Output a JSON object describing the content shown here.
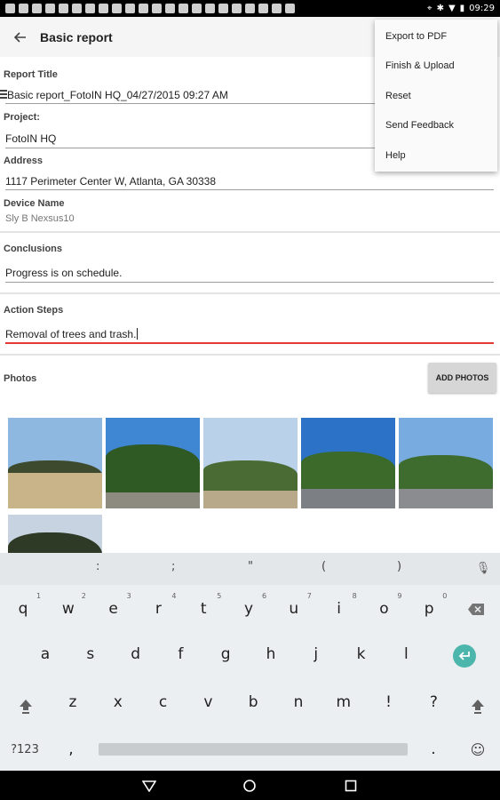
{
  "status_bar": {
    "time": "09:29",
    "left_icons": [
      "gmail-icon",
      "calendar-icon",
      "image-icon",
      "photos-icon",
      "twitter-icon",
      "twitter-icon",
      "snowflake-icon",
      "twitter-icon",
      "snowflake-icon",
      "snowflake-icon",
      "twitter-icon",
      "twitter-icon",
      "twitter-icon",
      "hangouts-icon",
      "twitter-icon",
      "card-icon",
      "sync-icon",
      "linkedin-icon",
      "linkedin-icon",
      "warning-icon",
      "notification-icon",
      "bag-icon"
    ]
  },
  "toolbar": {
    "title": "Basic report"
  },
  "menu": {
    "items": [
      "Export to PDF",
      "Finish & Upload",
      "Reset",
      "Send Feedback",
      "Help"
    ]
  },
  "form": {
    "report_title_label": "Report Title",
    "report_title_value": "Basic report_FotoIN HQ_04/27/2015 09:27 AM",
    "project_label": "Project:",
    "project_value": "FotoIN HQ",
    "address_label": "Address",
    "address_value": "1117 Perimeter Center W, Atlanta, GA 30338",
    "device_label": "Device Name",
    "device_value": "Sly B Nexsus10",
    "conclusions_label": "Conclusions",
    "conclusions_value": "Progress is on schedule.",
    "action_label": "Action Steps",
    "action_value": "Removal of trees and trash."
  },
  "photos": {
    "label": "Photos",
    "add_button": "ADD PHOTOS",
    "count": 6
  },
  "keyboard": {
    "suggestions": [
      ":",
      ";",
      "\"",
      "(",
      ")"
    ],
    "row1": [
      "q",
      "w",
      "e",
      "r",
      "t",
      "y",
      "u",
      "i",
      "o",
      "p"
    ],
    "row1_hints": [
      "1",
      "2",
      "3",
      "4",
      "5",
      "6",
      "7",
      "8",
      "9",
      "0"
    ],
    "row2": [
      "a",
      "s",
      "d",
      "f",
      "g",
      "h",
      "j",
      "k",
      "l"
    ],
    "row3": [
      "z",
      "x",
      "c",
      "v",
      "b",
      "n",
      "m",
      "!",
      "?"
    ],
    "symbols_key": "?123",
    "comma": ",",
    "period": ".",
    "emoji": "☺"
  },
  "colors": {
    "accent_red": "#e53935",
    "enter_teal": "#4db6ac"
  }
}
